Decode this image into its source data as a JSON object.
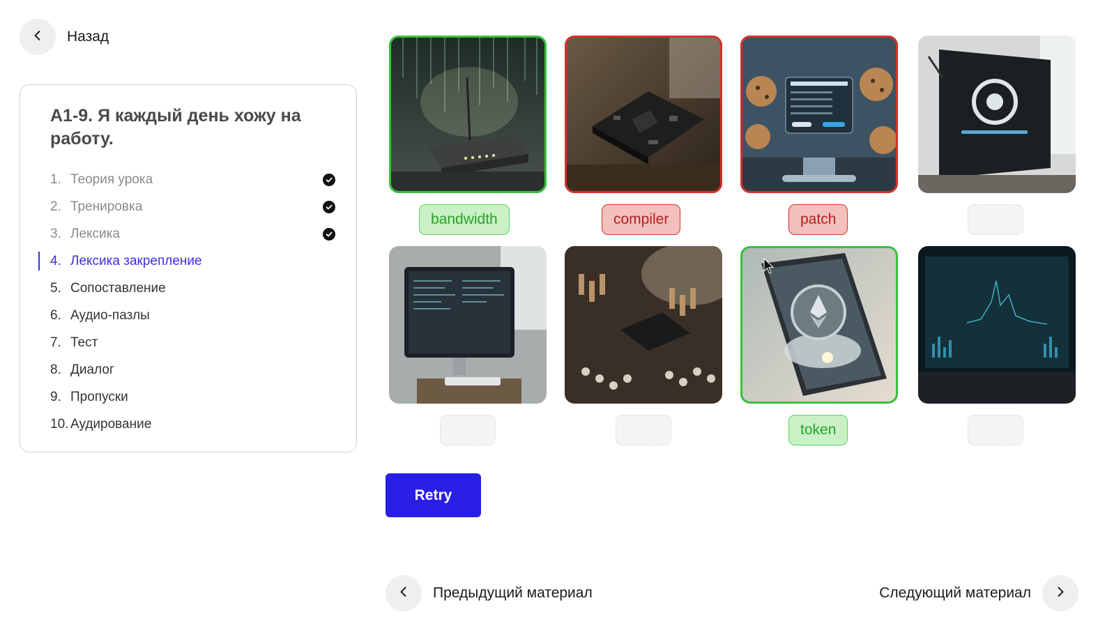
{
  "nav": {
    "back_label": "Назад",
    "back_icon": "chevron-left-icon"
  },
  "lesson": {
    "title": "A1-9. Я каждый день хожу на работу.",
    "items": [
      {
        "num": "1.",
        "label": "Теория урока",
        "status": "done"
      },
      {
        "num": "2.",
        "label": "Тренировка",
        "status": "done"
      },
      {
        "num": "3.",
        "label": "Лексика",
        "status": "done"
      },
      {
        "num": "4.",
        "label": "Лексика закрепление",
        "status": "active"
      },
      {
        "num": "5.",
        "label": "Сопоставление",
        "status": "pending"
      },
      {
        "num": "6.",
        "label": "Аудио-пазлы",
        "status": "pending"
      },
      {
        "num": "7.",
        "label": "Тест",
        "status": "pending"
      },
      {
        "num": "8.",
        "label": "Диалог",
        "status": "pending"
      },
      {
        "num": "9.",
        "label": "Пропуски",
        "status": "pending"
      },
      {
        "num": "10.",
        "label": "Аудирование",
        "status": "pending"
      }
    ]
  },
  "exercise": {
    "tiles": [
      {
        "image": "router-image",
        "word": "bandwidth",
        "state": "correct"
      },
      {
        "image": "motherboard-image",
        "word": "compiler",
        "state": "wrong"
      },
      {
        "image": "cookie-settings-image",
        "word": "patch",
        "state": "wrong"
      },
      {
        "image": "update-screen-image",
        "word": "",
        "state": "empty"
      },
      {
        "image": "code-monitor-image",
        "word": "",
        "state": "empty"
      },
      {
        "image": "circuit-board-image",
        "word": "",
        "state": "empty"
      },
      {
        "image": "crypto-phone-image",
        "word": "token",
        "state": "correct"
      },
      {
        "image": "dashboard-image",
        "word": "",
        "state": "empty"
      }
    ],
    "retry_label": "Retry",
    "colors": {
      "correct": "#36c23c",
      "wrong": "#d2322d",
      "accent": "#2a1fe6"
    }
  },
  "footer": {
    "prev_label": "Предыдущий материал",
    "next_label": "Следующий материал"
  }
}
